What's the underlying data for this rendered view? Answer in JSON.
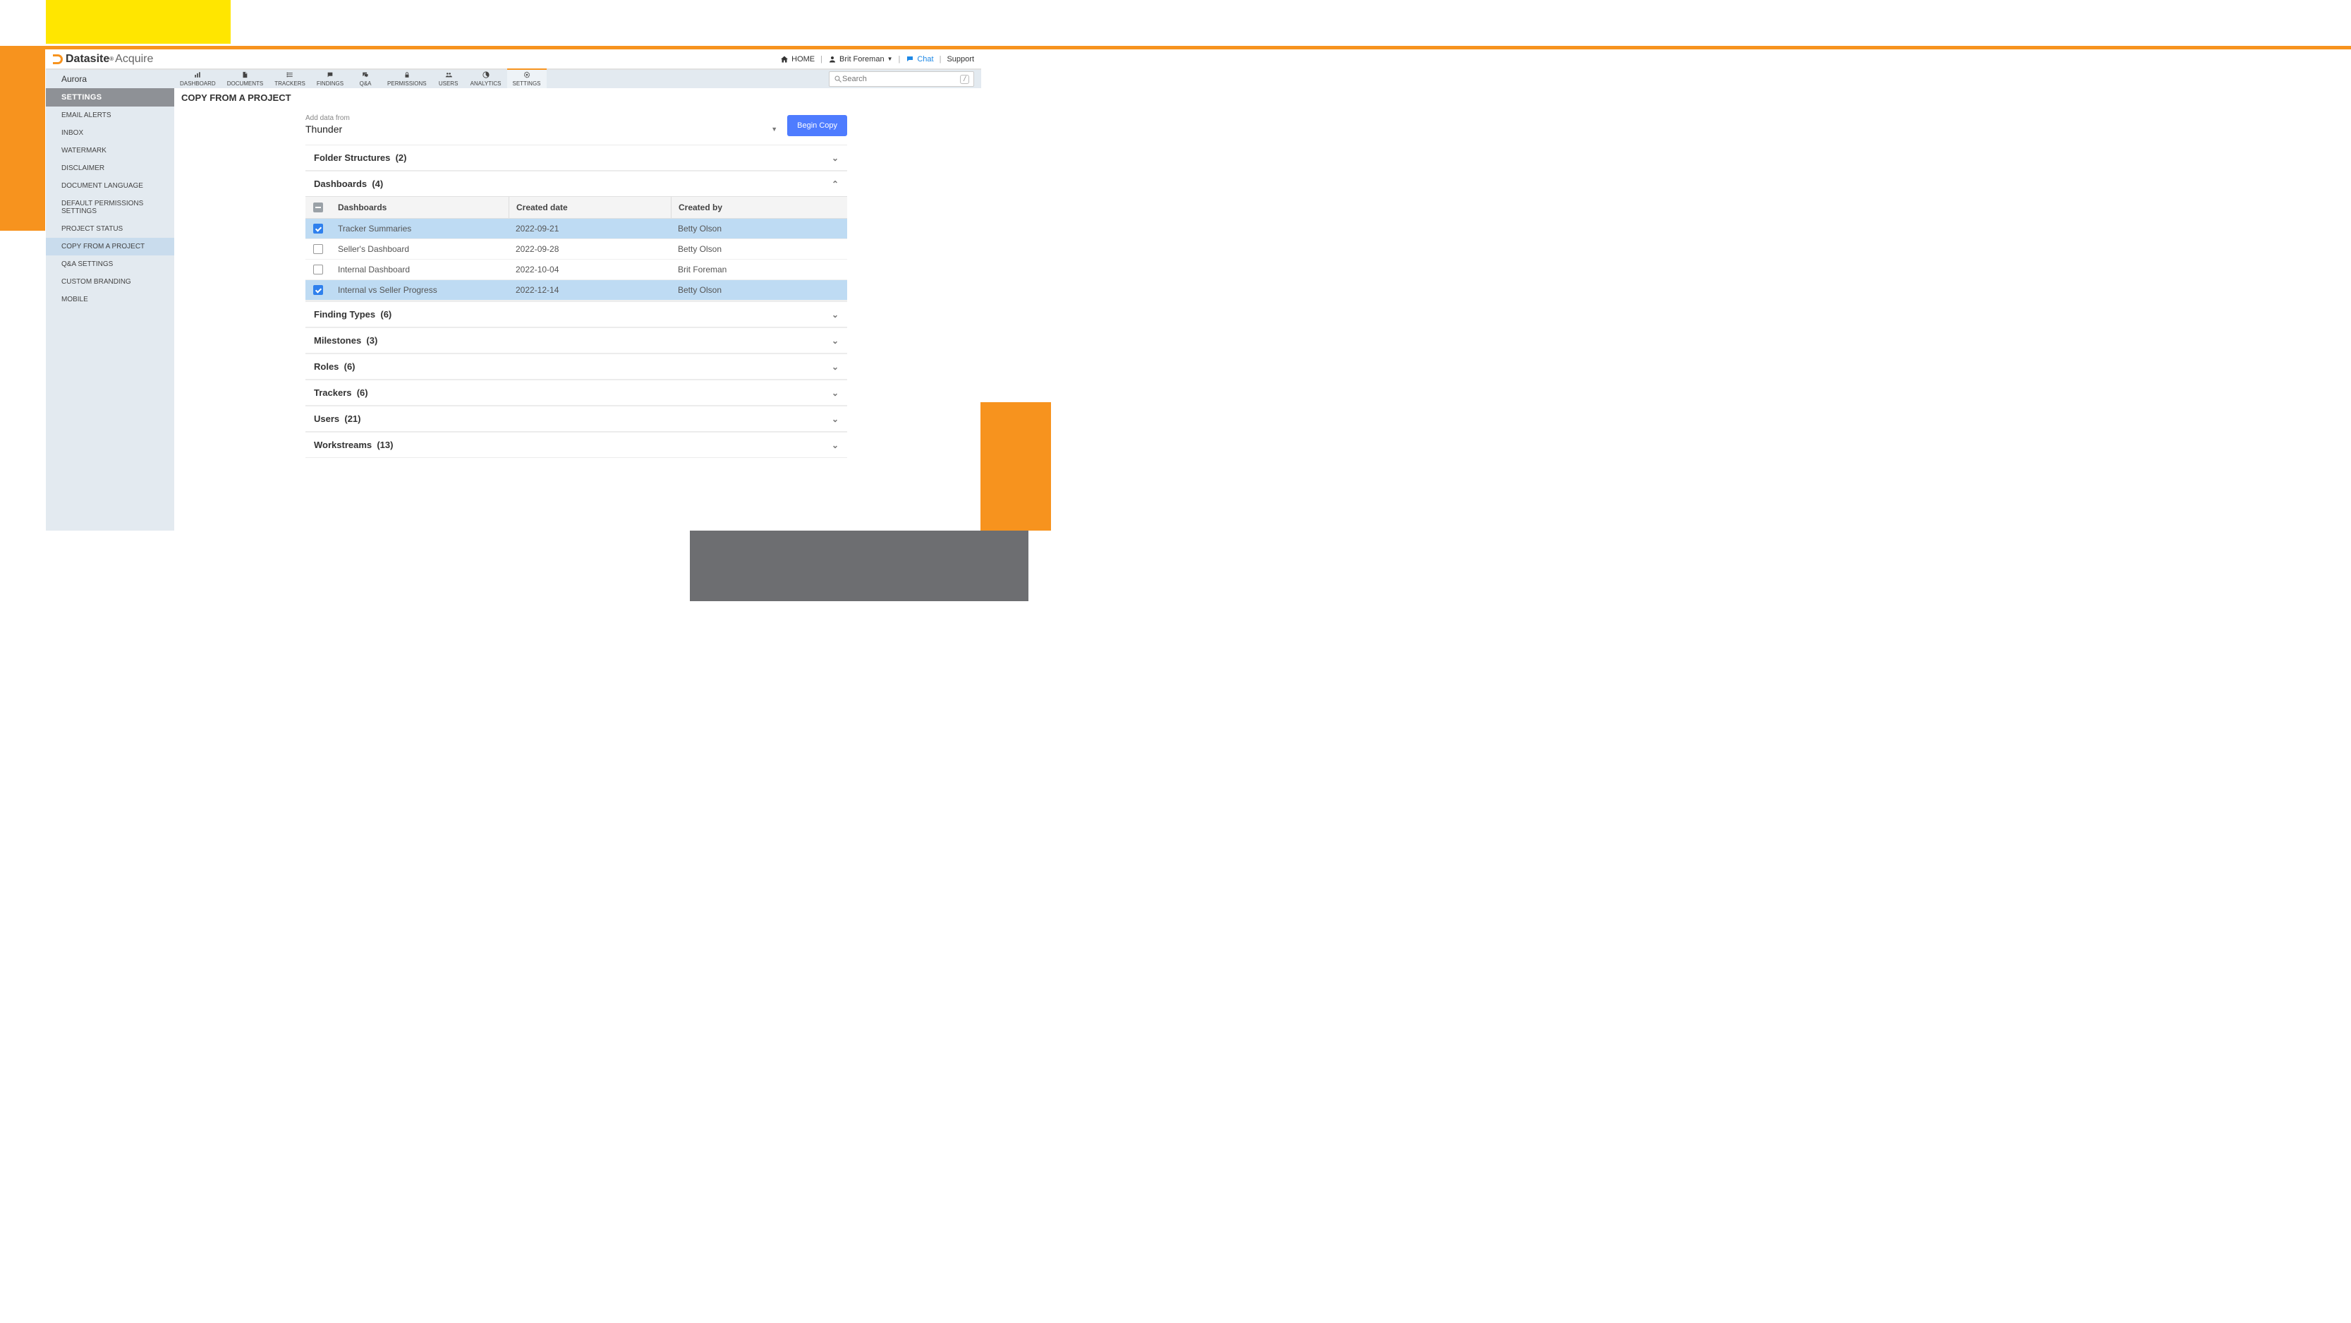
{
  "brand": {
    "name": "Datasite",
    "product": "Acquire"
  },
  "header": {
    "home": "HOME",
    "user": "Brit Foreman",
    "chat": "Chat",
    "support": "Support",
    "search_placeholder": "Search",
    "kbd_hint": "/"
  },
  "project_name": "Aurora",
  "tabs": [
    {
      "key": "dashboard",
      "label": "DASHBOARD"
    },
    {
      "key": "documents",
      "label": "DOCUMENTS"
    },
    {
      "key": "trackers",
      "label": "TRACKERS"
    },
    {
      "key": "findings",
      "label": "FINDINGS"
    },
    {
      "key": "qa",
      "label": "Q&A"
    },
    {
      "key": "permissions",
      "label": "PERMISSIONS"
    },
    {
      "key": "users",
      "label": "USERS"
    },
    {
      "key": "analytics",
      "label": "ANALYTICS"
    },
    {
      "key": "settings",
      "label": "SETTINGS"
    }
  ],
  "active_tab": "settings",
  "sidebar": {
    "title": "SETTINGS",
    "items": [
      "EMAIL ALERTS",
      "INBOX",
      "WATERMARK",
      "DISCLAIMER",
      "DOCUMENT LANGUAGE",
      "DEFAULT PERMISSIONS SETTINGS",
      "PROJECT STATUS",
      "COPY FROM A PROJECT",
      "Q&A SETTINGS",
      "CUSTOM BRANDING",
      "MOBILE"
    ],
    "active_index": 7
  },
  "page": {
    "title": "COPY FROM A PROJECT",
    "add_label": "Add data from",
    "source_project": "Thunder",
    "begin_button": "Begin Copy"
  },
  "sections": [
    {
      "label": "Folder Structures",
      "count": 2,
      "open": false
    },
    {
      "label": "Dashboards",
      "count": 4,
      "open": true
    },
    {
      "label": "Finding Types",
      "count": 6,
      "open": false
    },
    {
      "label": "Milestones",
      "count": 3,
      "open": false
    },
    {
      "label": "Roles",
      "count": 6,
      "open": false
    },
    {
      "label": "Trackers",
      "count": 6,
      "open": false
    },
    {
      "label": "Users",
      "count": 21,
      "open": false
    },
    {
      "label": "Workstreams",
      "count": 13,
      "open": false
    }
  ],
  "dashboards_table": {
    "columns": {
      "name": "Dashboards",
      "date": "Created date",
      "by": "Created by"
    },
    "rows": [
      {
        "selected": true,
        "name": "Tracker Summaries",
        "date": "2022-09-21",
        "by": "Betty Olson"
      },
      {
        "selected": false,
        "name": "Seller's Dashboard",
        "date": "2022-09-28",
        "by": "Betty Olson"
      },
      {
        "selected": false,
        "name": "Internal Dashboard",
        "date": "2022-10-04",
        "by": "Brit Foreman"
      },
      {
        "selected": true,
        "name": "Internal vs Seller Progress",
        "date": "2022-12-14",
        "by": "Betty Olson"
      }
    ]
  },
  "colors": {
    "accent_orange": "#f7931e",
    "accent_yellow": "#ffe600",
    "primary_blue": "#4e7cff"
  }
}
